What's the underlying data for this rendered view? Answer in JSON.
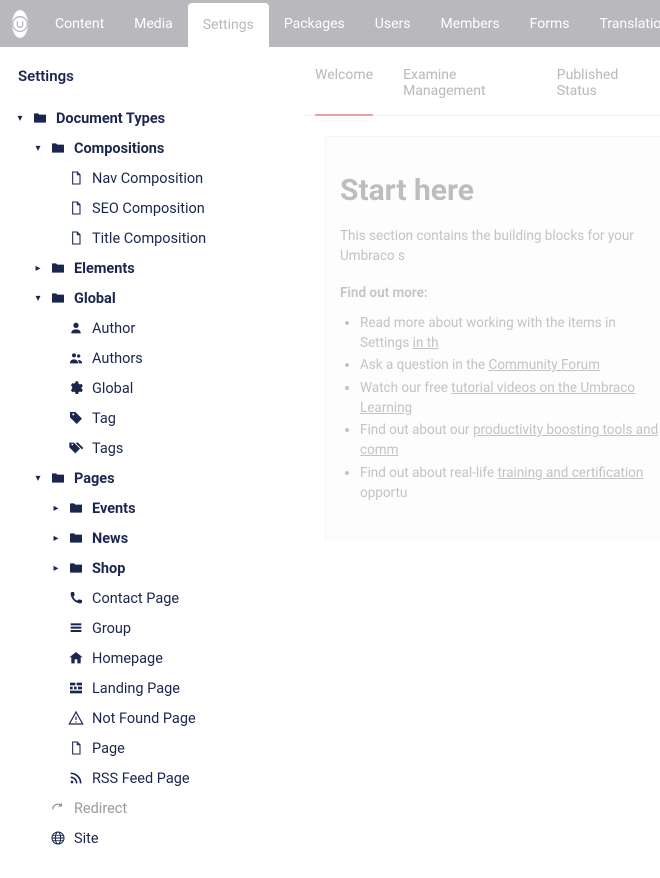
{
  "topnav": [
    "Content",
    "Media",
    "Settings",
    "Packages",
    "Users",
    "Members",
    "Forms",
    "Translation"
  ],
  "topnav_active": 2,
  "sidebar_title": "Settings",
  "tree": [
    {
      "label": "Document Types",
      "icon": "folder",
      "bold": true,
      "caret": "down",
      "children": [
        {
          "label": "Compositions",
          "icon": "folder",
          "bold": true,
          "caret": "down",
          "children": [
            {
              "label": "Nav Composition",
              "icon": "doc",
              "caret": "none"
            },
            {
              "label": "SEO Composition",
              "icon": "doc",
              "caret": "none"
            },
            {
              "label": "Title Composition",
              "icon": "doc",
              "caret": "none"
            }
          ]
        },
        {
          "label": "Elements",
          "icon": "folder",
          "bold": true,
          "caret": "right"
        },
        {
          "label": "Global",
          "icon": "folder",
          "bold": true,
          "caret": "down",
          "children": [
            {
              "label": "Author",
              "icon": "user",
              "caret": "none"
            },
            {
              "label": "Authors",
              "icon": "users",
              "caret": "none"
            },
            {
              "label": "Global",
              "icon": "gear",
              "caret": "none"
            },
            {
              "label": "Tag",
              "icon": "tag",
              "caret": "none"
            },
            {
              "label": "Tags",
              "icon": "tags",
              "caret": "none"
            }
          ]
        },
        {
          "label": "Pages",
          "icon": "folder",
          "bold": true,
          "caret": "down",
          "children": [
            {
              "label": "Events",
              "icon": "folder",
              "bold": true,
              "caret": "right"
            },
            {
              "label": "News",
              "icon": "folder",
              "bold": true,
              "caret": "right"
            },
            {
              "label": "Shop",
              "icon": "folder",
              "bold": true,
              "caret": "right"
            },
            {
              "label": "Contact Page",
              "icon": "phone",
              "caret": "none"
            },
            {
              "label": "Group",
              "icon": "group",
              "caret": "none"
            },
            {
              "label": "Homepage",
              "icon": "home",
              "caret": "none"
            },
            {
              "label": "Landing Page",
              "icon": "landing",
              "caret": "none"
            },
            {
              "label": "Not Found Page",
              "icon": "warning",
              "caret": "none"
            },
            {
              "label": "Page",
              "icon": "doc",
              "caret": "none"
            },
            {
              "label": "RSS Feed Page",
              "icon": "rss",
              "caret": "none"
            }
          ]
        },
        {
          "label": "Redirect",
          "icon": "redirect",
          "caret": "none",
          "gray": true
        },
        {
          "label": "Site",
          "icon": "globe",
          "caret": "none"
        }
      ]
    }
  ],
  "tabs": [
    "Welcome",
    "Examine Management",
    "Published Status"
  ],
  "tabs_active": 0,
  "panel": {
    "title": "Start here",
    "intro": "This section contains the building blocks for your Umbraco s",
    "findout": "Find out more:",
    "bullets": [
      [
        {
          "t": "Read more about working with the items in Settings "
        },
        {
          "t": "in th",
          "u": 1
        }
      ],
      [
        {
          "t": "Ask a question in the "
        },
        {
          "t": "Community Forum",
          "u": 1
        }
      ],
      [
        {
          "t": "Watch our free "
        },
        {
          "t": "tutorial videos on the Umbraco Learning",
          "u": 1
        }
      ],
      [
        {
          "t": "Find out about our "
        },
        {
          "t": "productivity boosting tools and comm",
          "u": 1
        }
      ],
      [
        {
          "t": "Find out about real-life "
        },
        {
          "t": "training and certification",
          "u": 1
        },
        {
          "t": " opportu"
        }
      ]
    ]
  }
}
